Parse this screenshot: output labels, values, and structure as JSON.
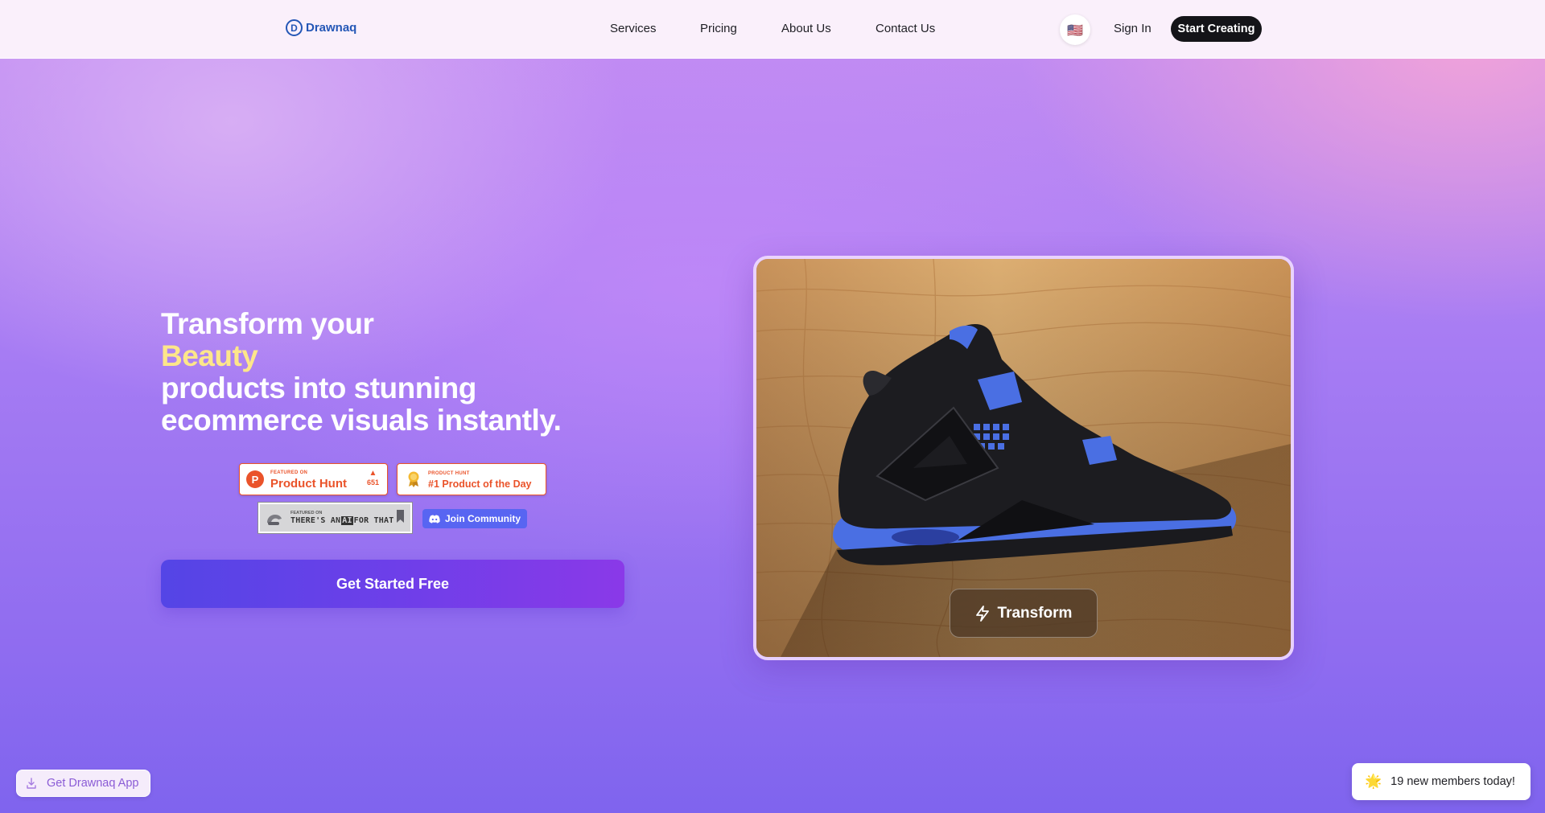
{
  "header": {
    "logo_text": "Drawnaq",
    "logo_mark": "D",
    "nav": [
      "Services",
      "Pricing",
      "About Us",
      "Contact Us"
    ],
    "language_flag": "🇺🇸",
    "sign_in": "Sign In",
    "start_creating": "Start Creating"
  },
  "hero": {
    "headline_line1": "Transform your",
    "headline_accent": "Beauty",
    "headline_line3": "products into stunning",
    "headline_line4": "ecommerce visuals instantly.",
    "accent_color": "#fde68a",
    "cta": "Get Started Free"
  },
  "badges": {
    "product_hunt": {
      "small": "FEATURED ON",
      "big": "Product Hunt",
      "votes": "651"
    },
    "product_of_day": {
      "small": "PRODUCT HUNT",
      "big": "#1 Product of the Day"
    },
    "aift": {
      "small": "FEATURED ON",
      "pre": "THERE'S AN",
      "ai": "AI",
      "post": "FOR THAT"
    },
    "discord": "Join Community"
  },
  "image_card": {
    "transform_label": "Transform",
    "icon": "lightning-icon"
  },
  "floating": {
    "app_button": "Get Drawnaq App",
    "toast_icon": "🌟",
    "toast_text": "19 new members today!"
  },
  "colors": {
    "brand_blue": "#2457b6",
    "product_hunt": "#ea532a",
    "discord": "#5865f2",
    "cta_start": "#5445e6",
    "cta_end": "#8a39e8"
  }
}
